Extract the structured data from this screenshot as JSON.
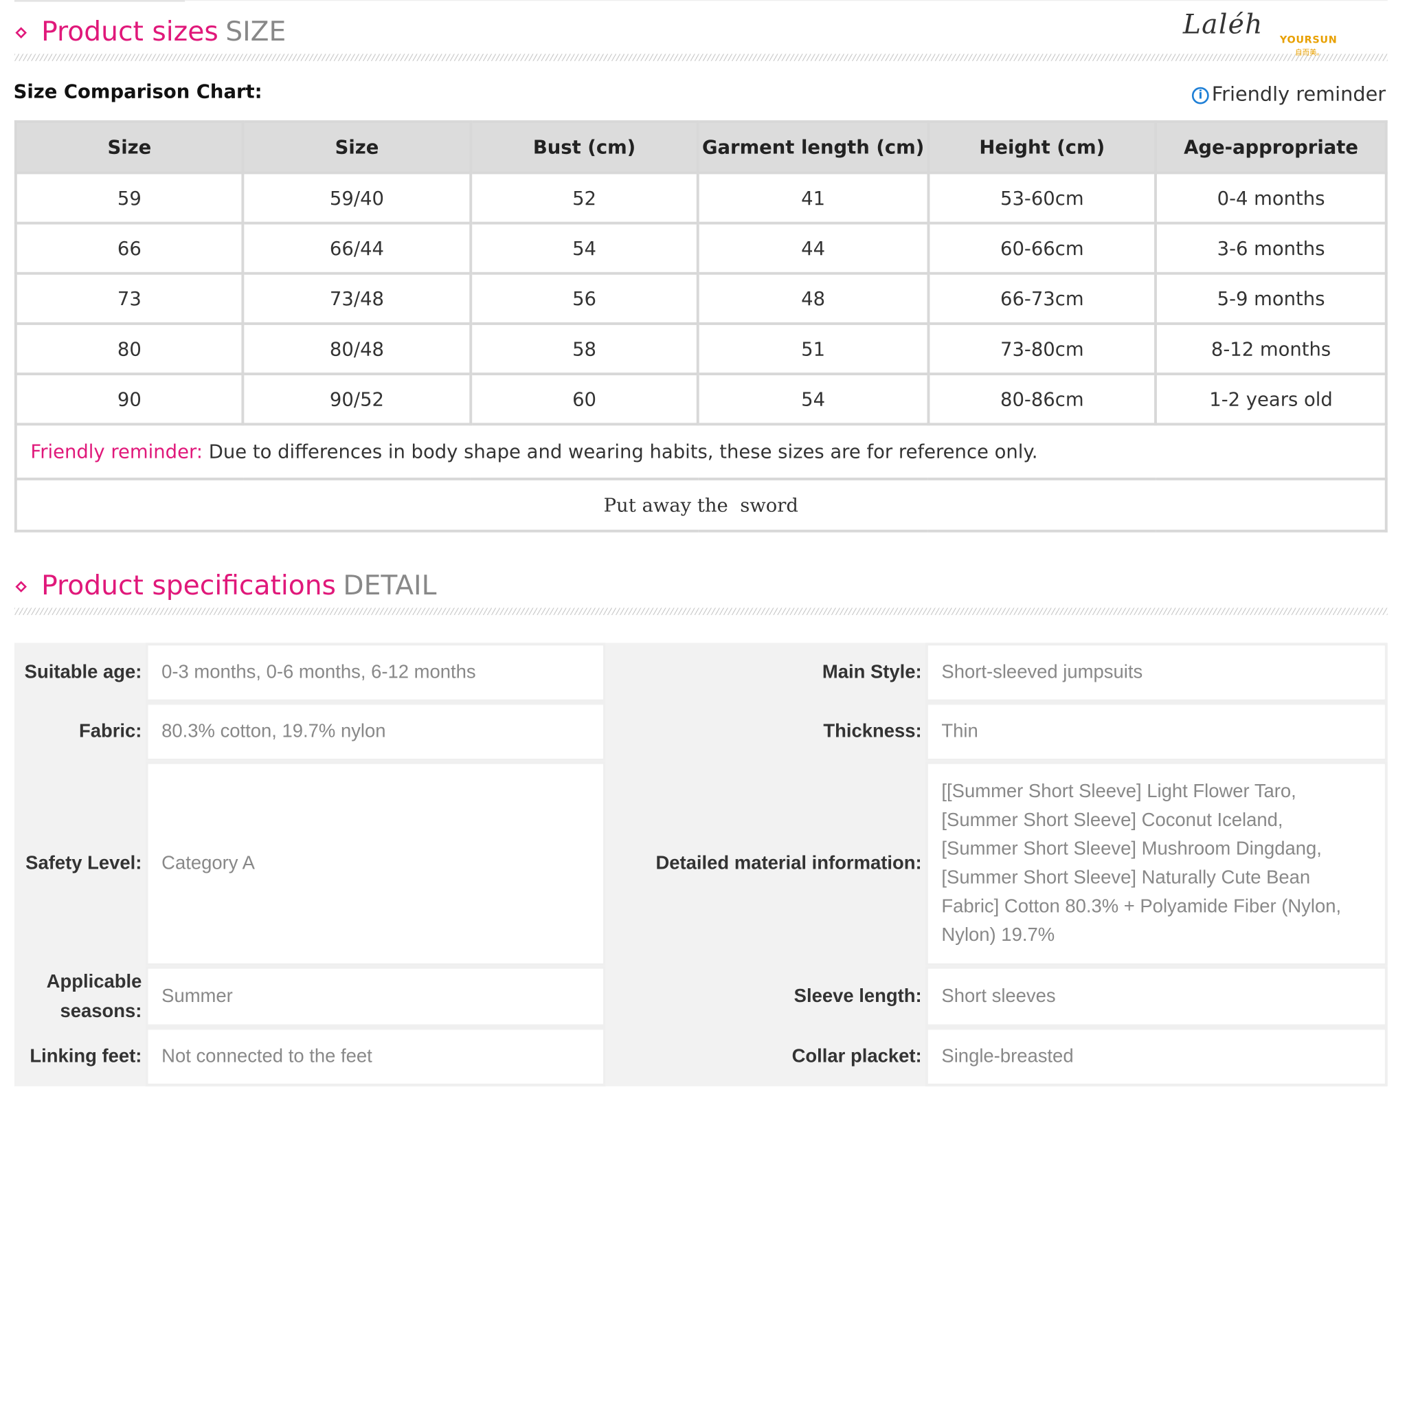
{
  "size_section": {
    "title": "Product sizes",
    "title_en": "SIZE",
    "chart_label": "Size Comparison Chart:",
    "reminder_link": "Friendly reminder",
    "columns": [
      "Size",
      "Size",
      "Bust (cm)",
      "Garment length (cm)",
      "Height (cm)",
      "Age-appropriate"
    ],
    "rows": [
      [
        "59",
        "59/40",
        "52",
        "41",
        "53-60cm",
        "0-4 months"
      ],
      [
        "66",
        "66/44",
        "54",
        "44",
        "60-66cm",
        "3-6 months"
      ],
      [
        "73",
        "73/48",
        "56",
        "48",
        "66-73cm",
        "5-9 months"
      ],
      [
        "80",
        "80/48",
        "58",
        "51",
        "73-80cm",
        "8-12 months"
      ],
      [
        "90",
        "90/52",
        "60",
        "54",
        "80-86cm",
        "1-2 years old"
      ]
    ],
    "note_label": "Friendly reminder:",
    "note_text": " Due to differences in body shape and wearing habits, these sizes are for reference only.",
    "footer": "Put away the  sword"
  },
  "logo": {
    "script": "Laléh",
    "brand": "YOURSUN",
    "brand_cn": "自而美。"
  },
  "spec_section": {
    "title": "Product specifications",
    "title_en": "DETAIL",
    "rows": [
      {
        "l_label": "Suitable age:",
        "l_value": "0-3 months, 0-6 months, 6-12 months",
        "r_label": "Main Style:",
        "r_value": "Short-sleeved jumpsuits"
      },
      {
        "l_label": "Fabric:",
        "l_value": "80.3% cotton, 19.7% nylon",
        "r_label": "Thickness:",
        "r_value": "Thin"
      },
      {
        "l_label": "Safety Level:",
        "l_value": "Category A",
        "r_label": "Detailed material information:",
        "r_value": "[[Summer Short Sleeve] Light Flower Taro,\n[Summer Short Sleeve] Coconut Iceland,\n[Summer Short Sleeve] Mushroom Dingdang,\n[Summer Short Sleeve] Naturally Cute Bean\nFabric] Cotton 80.3% + Polyamide Fiber (Nylon,\nNylon) 19.7%"
      },
      {
        "l_label": "Applicable\nseasons:",
        "l_value": "Summer",
        "r_label": "Sleeve length:",
        "r_value": "Short sleeves"
      },
      {
        "l_label": "Linking feet:",
        "l_value": "Not connected to the feet",
        "r_label": "Collar placket:",
        "r_value": "Single-breasted"
      }
    ]
  }
}
